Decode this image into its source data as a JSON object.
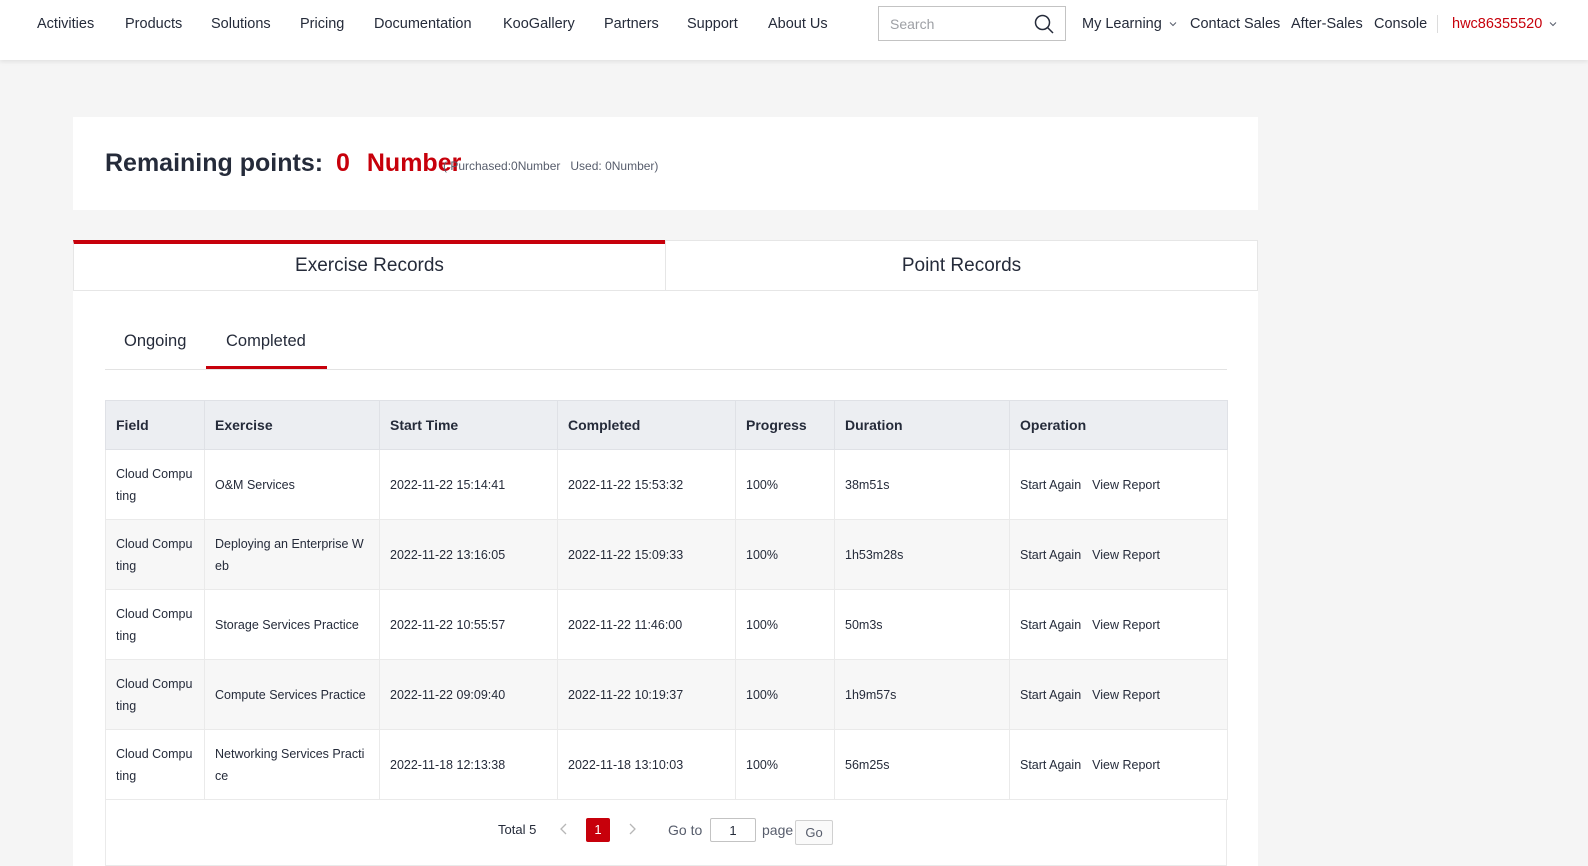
{
  "nav": {
    "items": [
      "Activities",
      "Products",
      "Solutions",
      "Pricing",
      "Documentation",
      "KooGallery",
      "Partners",
      "Support",
      "About Us"
    ],
    "search_placeholder": "Search",
    "my_learning": "My Learning",
    "contact_sales": "Contact Sales",
    "after_sales": "After-Sales",
    "console": "Console",
    "username": "hwc86355520"
  },
  "points": {
    "label": "Remaining points:",
    "value": "0",
    "unit": "Number",
    "detail": "( Purchased:0Number   Used: 0Number)"
  },
  "tabs": {
    "exercise_records": "Exercise Records",
    "point_records": "Point Records"
  },
  "subtabs": {
    "ongoing": "Ongoing",
    "completed": "Completed"
  },
  "table": {
    "headers": [
      "Field",
      "Exercise",
      "Start Time",
      "Completed",
      "Progress",
      "Duration",
      "Operation"
    ],
    "rows": [
      {
        "field": "Cloud Computing",
        "exercise": "O&M Services",
        "start": "2022-11-22 15:14:41",
        "completed": "2022-11-22 15:53:32",
        "progress": "100%",
        "duration": "38m51s"
      },
      {
        "field": "Cloud Computing",
        "exercise": "Deploying an Enterprise Web",
        "start": "2022-11-22 13:16:05",
        "completed": "2022-11-22 15:09:33",
        "progress": "100%",
        "duration": "1h53m28s"
      },
      {
        "field": "Cloud Computing",
        "exercise": "Storage Services Practice",
        "start": "2022-11-22 10:55:57",
        "completed": "2022-11-22 11:46:00",
        "progress": "100%",
        "duration": "50m3s"
      },
      {
        "field": "Cloud Computing",
        "exercise": "Compute Services Practice",
        "start": "2022-11-22 09:09:40",
        "completed": "2022-11-22 10:19:37",
        "progress": "100%",
        "duration": "1h9m57s"
      },
      {
        "field": "Cloud Computing",
        "exercise": "Networking Services Practice",
        "start": "2022-11-18 12:13:38",
        "completed": "2022-11-18 13:10:03",
        "progress": "100%",
        "duration": "56m25s"
      }
    ],
    "op_start_again": "Start Again",
    "op_view_report": "View Report"
  },
  "pagination": {
    "total": "Total 5",
    "current": "1",
    "goto_label": "Go to",
    "goto_value": "1",
    "page_label": "page",
    "go_button": "Go"
  },
  "colors": {
    "accent": "#c7000b",
    "header_bg": "#eceef2",
    "page_bg": "#f5f5f5"
  }
}
